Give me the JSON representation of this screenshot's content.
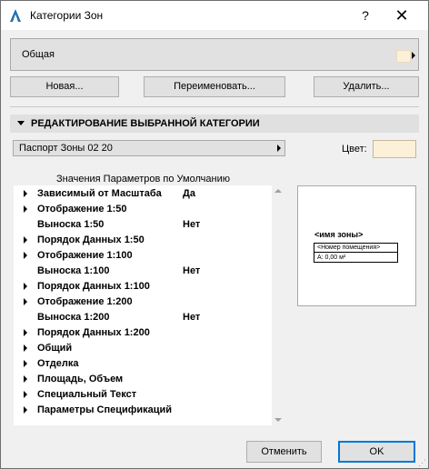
{
  "window": {
    "title": "Категории Зон",
    "help_label": "?",
    "close_label": "✕"
  },
  "category": {
    "selected": "Общая",
    "swatch_color": "#fdf0d8"
  },
  "actions": {
    "new_label": "Новая...",
    "rename_label": "Переименовать...",
    "delete_label": "Удалить..."
  },
  "section": {
    "title": "РЕДАКТИРОВАНИЕ ВЫБРАННОЙ КАТЕГОРИИ"
  },
  "passport": {
    "value": "Паспорт Зоны 02 20"
  },
  "color": {
    "label": "Цвет:",
    "value": "#fdf0d8"
  },
  "params": {
    "label": "Значения Параметров по Умолчанию",
    "items": [
      {
        "name": "Зависимый от Масштаба",
        "value": "Да",
        "expandable": true
      },
      {
        "name": "Отображение 1:50",
        "value": "",
        "expandable": true
      },
      {
        "name": "Выноска 1:50",
        "value": "Нет",
        "expandable": false
      },
      {
        "name": "Порядок Данных 1:50",
        "value": "",
        "expandable": true
      },
      {
        "name": "Отображение 1:100",
        "value": "",
        "expandable": true
      },
      {
        "name": "Выноска 1:100",
        "value": "Нет",
        "expandable": false
      },
      {
        "name": "Порядок Данных 1:100",
        "value": "",
        "expandable": true
      },
      {
        "name": "Отображение 1:200",
        "value": "",
        "expandable": true
      },
      {
        "name": "Выноска 1:200",
        "value": "Нет",
        "expandable": false
      },
      {
        "name": "Порядок Данных 1:200",
        "value": "",
        "expandable": true
      },
      {
        "name": "Общий",
        "value": "",
        "expandable": true
      },
      {
        "name": "Отделка",
        "value": "",
        "expandable": true
      },
      {
        "name": "Площадь, Объем",
        "value": "",
        "expandable": true
      },
      {
        "name": "Специальный Текст",
        "value": "",
        "expandable": true
      },
      {
        "name": "Параметры Спецификаций",
        "value": "",
        "expandable": true
      }
    ]
  },
  "preview": {
    "zone_name": "<имя зоны>",
    "room_number": "<Номер помещения>",
    "area": "A: 0,00 м²"
  },
  "footer": {
    "cancel_label": "Отменить",
    "ok_label": "OK"
  }
}
